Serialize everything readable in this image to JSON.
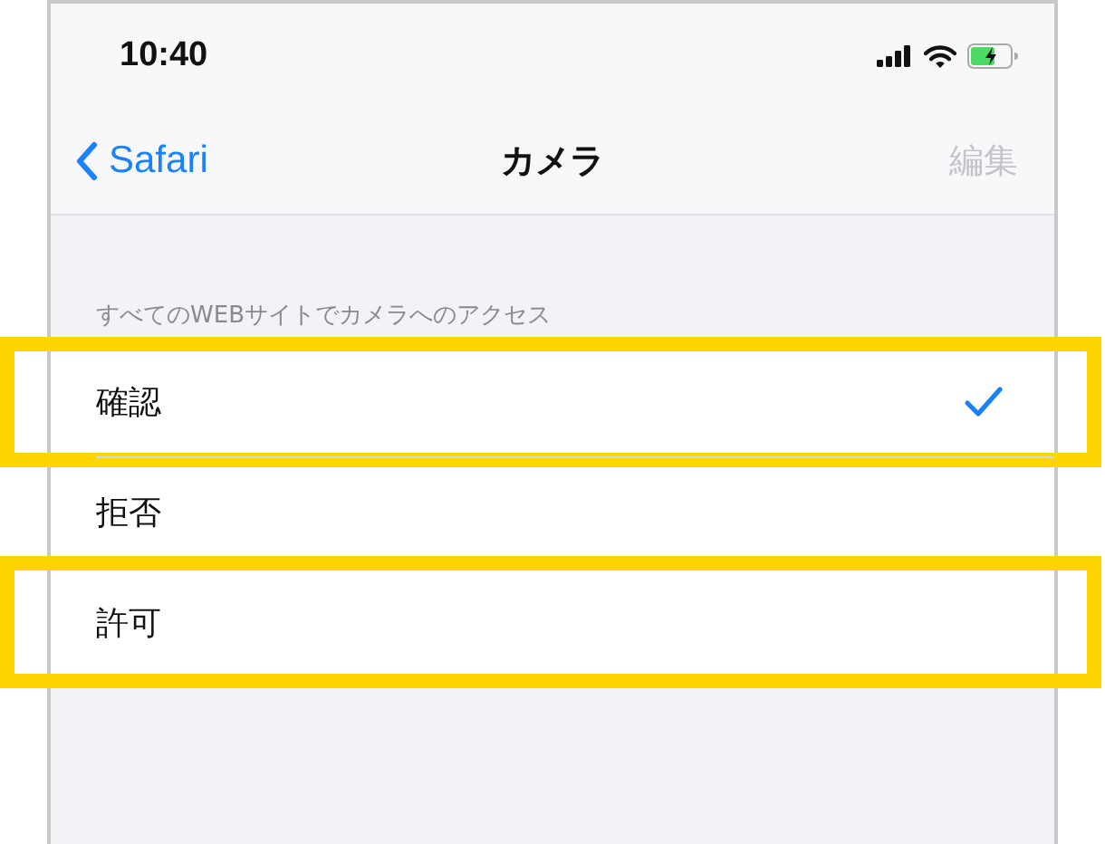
{
  "status_bar": {
    "time": "10:40"
  },
  "nav_bar": {
    "back": "Safari",
    "title": "カメラ",
    "edit": {
      "label": "編集",
      "disabled": true
    }
  },
  "section": {
    "header": "すべてのWEBサイトでカメラへのアクセス",
    "options": [
      {
        "label": "確認",
        "selected": true,
        "highlighted": true
      },
      {
        "label": "拒否",
        "selected": false,
        "highlighted": false
      },
      {
        "label": "許可",
        "selected": false,
        "highlighted": true
      }
    ]
  }
}
